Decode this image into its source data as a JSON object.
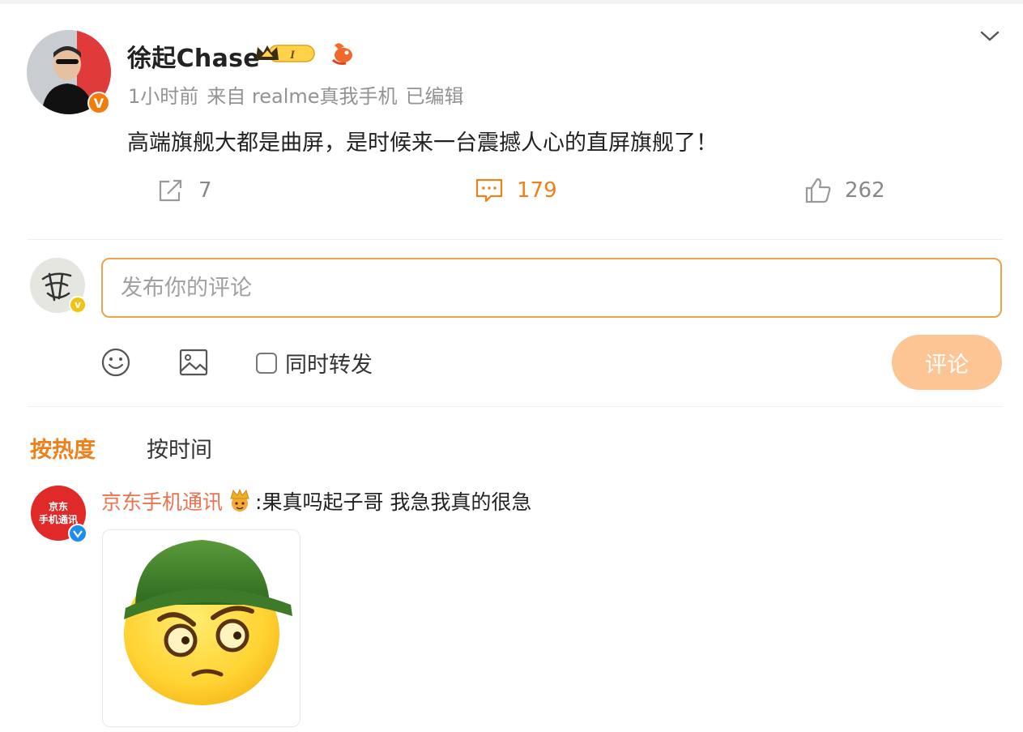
{
  "post": {
    "author": "徐起Chase",
    "badge_level": "I",
    "time": "1小时前",
    "source": "来自 realme真我手机",
    "edited": "已编辑",
    "text": "高端旗舰大都是曲屏，是时候来一台震撼人心的直屏旗舰了！",
    "actions": {
      "repost_count": "7",
      "comment_count": "179",
      "like_count": "262"
    }
  },
  "composer": {
    "placeholder": "发布你的评论",
    "also_repost_label": "同时转发",
    "submit_label": "评论"
  },
  "sort_tabs": {
    "hot": "按热度",
    "time": "按时间"
  },
  "comments": [
    {
      "user": "京东手机通讯",
      "avatar_text_line1": "京东",
      "avatar_text_line2": "手机通讯",
      "text": ":果真吗起子哥 我急我真的很急"
    }
  ],
  "colors": {
    "accent": "#f08019",
    "input_border": "#eba44a",
    "button_disabled": "#fdc593",
    "username": "#eb7350"
  },
  "icons": [
    "chevron-down-icon",
    "repost-icon",
    "comment-icon",
    "like-icon",
    "emoji-icon",
    "image-icon",
    "verified-icon",
    "crown-icon",
    "flame-icon"
  ]
}
